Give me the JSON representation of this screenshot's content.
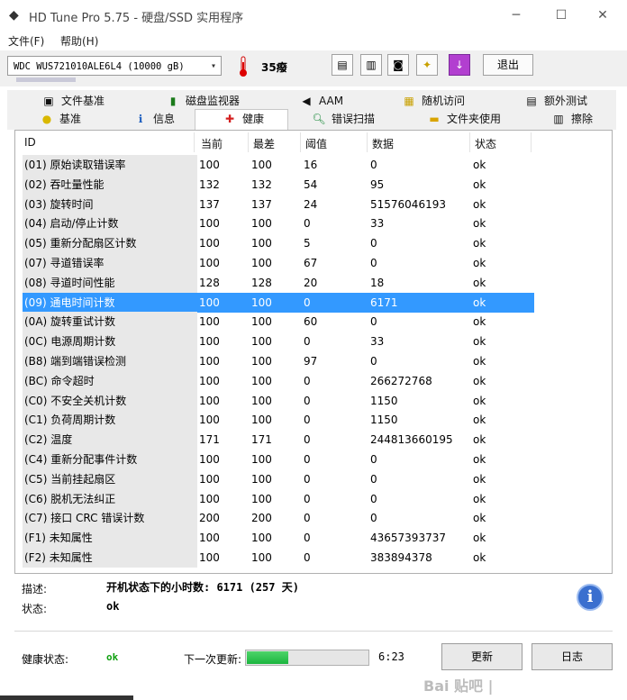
{
  "window": {
    "title": "HD Tune Pro 5.75 - 硬盘/SSD 实用程序",
    "minimize": "─",
    "maximize": "☐",
    "close": "✕"
  },
  "menu": [
    "文件(F)",
    "帮助(H)"
  ],
  "toolbar": {
    "drive": "WDC  WUS721010ALE6L4 (10000 gB)",
    "temperature": "35癈",
    "exit_label": "退出"
  },
  "tabs_row1": [
    {
      "label": "文件基准",
      "icon": "file-benchmark-icon"
    },
    {
      "label": "磁盘监视器",
      "icon": "disk-monitor-icon"
    },
    {
      "label": "AAM",
      "icon": "aam-speaker-icon"
    },
    {
      "label": "随机访问",
      "icon": "random-access-icon"
    },
    {
      "label": "额外测试",
      "icon": "extra-tests-icon"
    }
  ],
  "tabs_row2": [
    {
      "label": "基准",
      "icon": "benchmark-icon"
    },
    {
      "label": "信息",
      "icon": "info-icon"
    },
    {
      "label": "健康",
      "icon": "health-cross-icon",
      "active": true
    },
    {
      "label": "错误扫描",
      "icon": "error-scan-icon"
    },
    {
      "label": "文件夹使用",
      "icon": "folder-icon"
    },
    {
      "label": "擦除",
      "icon": "erase-icon"
    }
  ],
  "table": {
    "headers": {
      "id": "ID",
      "current": "当前",
      "worst": "最差",
      "threshold": "阈值",
      "data": "数据",
      "status": "状态"
    },
    "rows": [
      {
        "id": "(01) 原始读取错误率",
        "current": "100",
        "worst": "100",
        "threshold": "16",
        "data": "0",
        "status": "ok"
      },
      {
        "id": "(02) 吞吐量性能",
        "current": "132",
        "worst": "132",
        "threshold": "54",
        "data": "95",
        "status": "ok"
      },
      {
        "id": "(03) 旋转时间",
        "current": "137",
        "worst": "137",
        "threshold": "24",
        "data": "51576046193",
        "status": "ok"
      },
      {
        "id": "(04) 启动/停止计数",
        "current": "100",
        "worst": "100",
        "threshold": "0",
        "data": "33",
        "status": "ok"
      },
      {
        "id": "(05) 重新分配扇区计数",
        "current": "100",
        "worst": "100",
        "threshold": "5",
        "data": "0",
        "status": "ok"
      },
      {
        "id": "(07) 寻道错误率",
        "current": "100",
        "worst": "100",
        "threshold": "67",
        "data": "0",
        "status": "ok"
      },
      {
        "id": "(08) 寻道时间性能",
        "current": "128",
        "worst": "128",
        "threshold": "20",
        "data": "18",
        "status": "ok"
      },
      {
        "id": "(09) 通电时间计数",
        "current": "100",
        "worst": "100",
        "threshold": "0",
        "data": "6171",
        "status": "ok",
        "selected": true
      },
      {
        "id": "(0A) 旋转重试计数",
        "current": "100",
        "worst": "100",
        "threshold": "60",
        "data": "0",
        "status": "ok"
      },
      {
        "id": "(0C) 电源周期计数",
        "current": "100",
        "worst": "100",
        "threshold": "0",
        "data": "33",
        "status": "ok"
      },
      {
        "id": "(B8) 端到端错误检测",
        "current": "100",
        "worst": "100",
        "threshold": "97",
        "data": "0",
        "status": "ok"
      },
      {
        "id": "(BC) 命令超时",
        "current": "100",
        "worst": "100",
        "threshold": "0",
        "data": "266272768",
        "status": "ok"
      },
      {
        "id": "(C0) 不安全关机计数",
        "current": "100",
        "worst": "100",
        "threshold": "0",
        "data": "1150",
        "status": "ok"
      },
      {
        "id": "(C1) 负荷周期计数",
        "current": "100",
        "worst": "100",
        "threshold": "0",
        "data": "1150",
        "status": "ok"
      },
      {
        "id": "(C2) 温度",
        "current": "171",
        "worst": "171",
        "threshold": "0",
        "data": "244813660195",
        "status": "ok"
      },
      {
        "id": "(C4) 重新分配事件计数",
        "current": "100",
        "worst": "100",
        "threshold": "0",
        "data": "0",
        "status": "ok"
      },
      {
        "id": "(C5) 当前挂起扇区",
        "current": "100",
        "worst": "100",
        "threshold": "0",
        "data": "0",
        "status": "ok"
      },
      {
        "id": "(C6) 脱机无法纠正",
        "current": "100",
        "worst": "100",
        "threshold": "0",
        "data": "0",
        "status": "ok"
      },
      {
        "id": "(C7) 接口 CRC 错误计数",
        "current": "200",
        "worst": "200",
        "threshold": "0",
        "data": "0",
        "status": "ok"
      },
      {
        "id": "(F1) 未知属性",
        "current": "100",
        "worst": "100",
        "threshold": "0",
        "data": "43657393737",
        "status": "ok"
      },
      {
        "id": "(F2) 未知属性",
        "current": "100",
        "worst": "100",
        "threshold": "0",
        "data": "383894378",
        "status": "ok"
      }
    ]
  },
  "details": {
    "desc_label": "描述:",
    "desc_value": "开机状态下的小时数: 6171 (257 天)",
    "status_label": "状态:",
    "status_value": "ok"
  },
  "footer": {
    "health_label": "健康状态:",
    "health_value": "ok",
    "next_update_label": "下一次更新:",
    "progress": 0.35,
    "timer": "6:23",
    "refresh_label": "更新",
    "log_label": "日志"
  },
  "watermark": "Bai 贴吧 |",
  "colors": {
    "selection": "#3399ff",
    "health_ok": "#10a010",
    "progress": "#1bb53e",
    "info": "#3a6fcf"
  }
}
